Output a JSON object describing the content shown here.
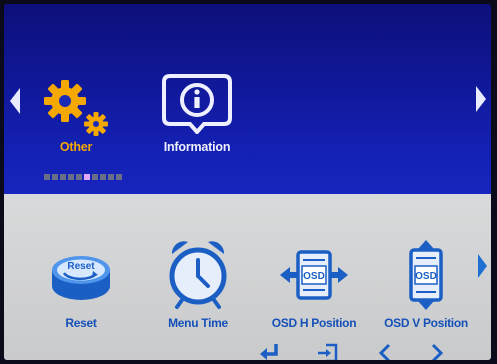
{
  "top_menu": {
    "categories": [
      {
        "label": "Other",
        "icon": "gear-icon",
        "color": "#f5a800",
        "selected": true
      },
      {
        "label": "Information",
        "icon": "info-icon",
        "color": "#eef0ff",
        "selected": false
      }
    ],
    "page_indicator": {
      "total": 10,
      "active_index": 5
    }
  },
  "submenu": {
    "items": [
      {
        "label": "Reset",
        "icon": "reset-icon"
      },
      {
        "label": "Menu Time",
        "icon": "alarm-clock-icon"
      },
      {
        "label": "OSD H Position",
        "icon": "osd-h-position-icon",
        "icon_text": "OSD"
      },
      {
        "label": "OSD V Position",
        "icon": "osd-v-position-icon",
        "icon_text": "OSD"
      }
    ],
    "reset_icon_text": "Reset"
  },
  "controls": [
    {
      "icon": "enter-icon"
    },
    {
      "icon": "exit-icon"
    },
    {
      "icon": "chevron-left-icon"
    },
    {
      "icon": "chevron-right-icon"
    }
  ],
  "colors": {
    "accent_orange": "#f5a800",
    "top_blue": "#1422b8",
    "item_blue": "#1550b8",
    "panel_gray": "#d2d3d4"
  }
}
